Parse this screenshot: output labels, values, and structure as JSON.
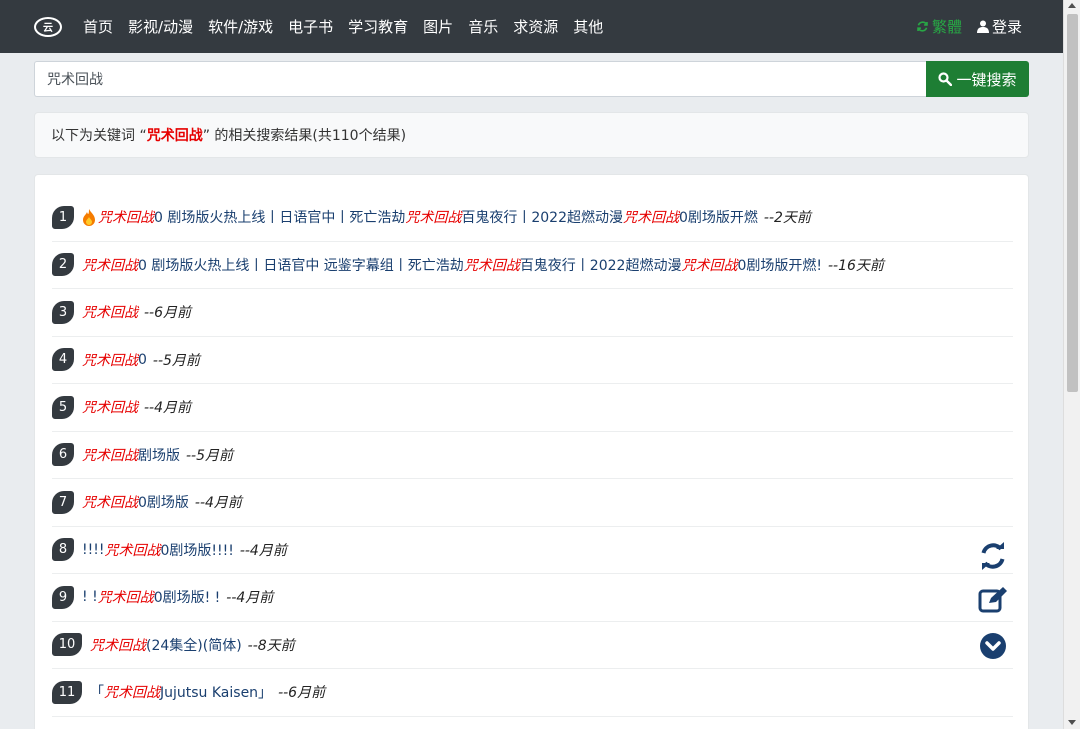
{
  "nav": {
    "logo_text": "云",
    "links": [
      "首页",
      "影视/动漫",
      "软件/游戏",
      "电子书",
      "学习教育",
      "图片",
      "音乐",
      "求资源",
      "其他"
    ],
    "traditional_label": "繁體",
    "login_label": "登录"
  },
  "search": {
    "value": "咒术回战",
    "button_label": "一键搜索"
  },
  "info": {
    "prefix": "以下为关键词 “",
    "keyword": "咒术回战",
    "suffix": "” 的相关搜索结果(共110个结果)"
  },
  "results": [
    {
      "num": "1",
      "fire": true,
      "pre": "",
      "hl": "咒术回战",
      "mid": "0 剧场版火热上线丨日语官中丨死亡浩劫",
      "hl2": "咒术回战",
      "mid2": "百鬼夜行丨2022超燃动漫",
      "hl3": "咒术回战",
      "post": "0剧场版开燃",
      "time": "--2天前"
    },
    {
      "num": "2",
      "fire": false,
      "pre": "",
      "hl": "咒术回战",
      "mid": "0 剧场版火热上线丨日语官中 远鉴字幕组丨死亡浩劫",
      "hl2": "咒术回战",
      "mid2": "百鬼夜行丨2022超燃动漫",
      "hl3": "咒术回战",
      "post": "0剧场版开燃!",
      "time": "--16天前"
    },
    {
      "num": "3",
      "fire": false,
      "pre": "",
      "hl": "咒术回战",
      "mid": "",
      "hl2": "",
      "mid2": "",
      "hl3": "",
      "post": "",
      "time": "--6月前"
    },
    {
      "num": "4",
      "fire": false,
      "pre": "",
      "hl": "咒术回战",
      "mid": "",
      "hl2": "",
      "mid2": "",
      "hl3": "",
      "post": "0",
      "time": "--5月前"
    },
    {
      "num": "5",
      "fire": false,
      "pre": "",
      "hl": "咒术回战",
      "mid": "",
      "hl2": "",
      "mid2": "",
      "hl3": "",
      "post": "",
      "time": "--4月前"
    },
    {
      "num": "6",
      "fire": false,
      "pre": "",
      "hl": "咒术回战",
      "mid": "",
      "hl2": "",
      "mid2": "",
      "hl3": "",
      "post": "剧场版",
      "time": "--5月前"
    },
    {
      "num": "7",
      "fire": false,
      "pre": "",
      "hl": "咒术回战",
      "mid": "",
      "hl2": "",
      "mid2": "",
      "hl3": "",
      "post": "0剧场版",
      "time": "--4月前"
    },
    {
      "num": "8",
      "fire": false,
      "pre": "!!!!",
      "hl": "咒术回战",
      "mid": "",
      "hl2": "",
      "mid2": "",
      "hl3": "",
      "post": "0剧场版!!!!",
      "time": "--4月前"
    },
    {
      "num": "9",
      "fire": false,
      "pre": "! ! ",
      "hl": "咒术回战",
      "mid": "",
      "hl2": "",
      "mid2": "",
      "hl3": "",
      "post": "0剧场版! ! ",
      "time": "--4月前"
    },
    {
      "num": "10",
      "fire": false,
      "pre": "",
      "hl": "咒术回战",
      "mid": "",
      "hl2": "",
      "mid2": "",
      "hl3": "",
      "post": " (24集全)(简体)",
      "time": "--8天前"
    },
    {
      "num": "11",
      "fire": false,
      "pre": "「",
      "hl": "咒术回战",
      "mid": "",
      "hl2": "",
      "mid2": "",
      "hl3": "",
      "post": "Jujutsu Kaisen」",
      "time": "--6月前"
    }
  ],
  "side_icons": [
    "refresh-icon",
    "edit-icon",
    "chevron-down-circle-icon"
  ],
  "colors": {
    "navbar": "#343a40",
    "highlight": "#e60000",
    "search_button": "#1e7e34",
    "traditional": "#28a745"
  }
}
